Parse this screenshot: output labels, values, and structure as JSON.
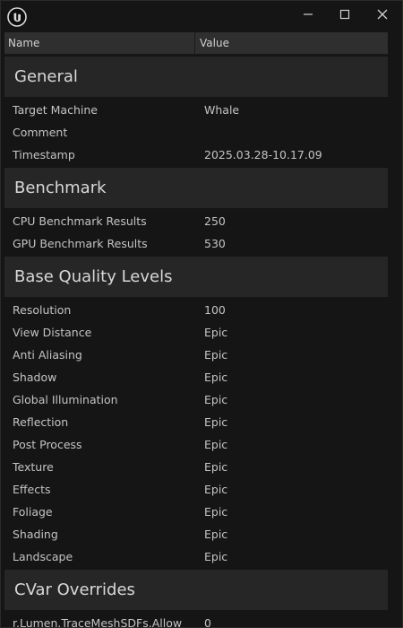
{
  "window": {
    "controls": {
      "minimize": "minimize-icon",
      "maximize": "maximize-icon",
      "close": "close-icon"
    },
    "logo": "unreal-engine-logo"
  },
  "table": {
    "columns": {
      "name": "Name",
      "value": "Value"
    },
    "sections": [
      {
        "title": "General",
        "rows": [
          {
            "name": "Target Machine",
            "value": "Whale"
          },
          {
            "name": "Comment",
            "value": ""
          },
          {
            "name": "Timestamp",
            "value": "2025.03.28-10.17.09"
          }
        ]
      },
      {
        "title": "Benchmark",
        "rows": [
          {
            "name": "CPU Benchmark Results",
            "value": "250"
          },
          {
            "name": "GPU Benchmark Results",
            "value": "530"
          }
        ]
      },
      {
        "title": "Base Quality Levels",
        "rows": [
          {
            "name": "Resolution",
            "value": "100"
          },
          {
            "name": "View Distance",
            "value": "Epic"
          },
          {
            "name": "Anti Aliasing",
            "value": "Epic"
          },
          {
            "name": "Shadow",
            "value": "Epic"
          },
          {
            "name": "Global Illumination",
            "value": "Epic"
          },
          {
            "name": "Reflection",
            "value": "Epic"
          },
          {
            "name": "Post Process",
            "value": "Epic"
          },
          {
            "name": "Texture",
            "value": "Epic"
          },
          {
            "name": "Effects",
            "value": "Epic"
          },
          {
            "name": "Foliage",
            "value": "Epic"
          },
          {
            "name": "Shading",
            "value": "Epic"
          },
          {
            "name": "Landscape",
            "value": "Epic"
          }
        ]
      },
      {
        "title": "CVar Overrides",
        "rows": [
          {
            "name": "r.Lumen.TraceMeshSDFs.Allow",
            "value": "0"
          }
        ]
      }
    ]
  },
  "colors": {
    "background": "#151515",
    "header": "#2f2f2f",
    "section": "#262626",
    "text": "#c4c4c4"
  }
}
